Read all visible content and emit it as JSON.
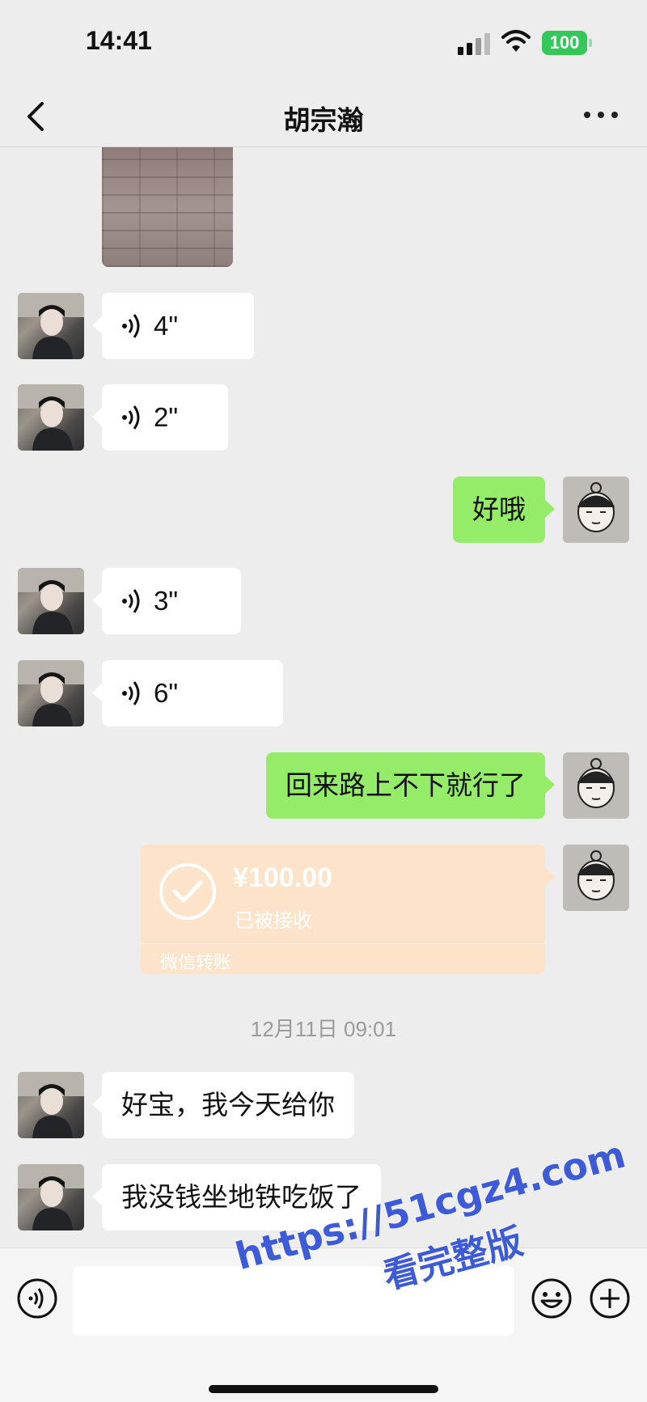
{
  "status_bar": {
    "time": "14:41",
    "battery": "100",
    "icons": [
      "signal-icon",
      "wifi-icon",
      "battery-icon"
    ]
  },
  "nav": {
    "title": "胡宗瀚",
    "back_icon": "chevron-left-icon",
    "more_icon": "more-dots-icon"
  },
  "messages": [
    {
      "type": "image",
      "side": "in"
    },
    {
      "type": "voice",
      "side": "in",
      "duration": "4\""
    },
    {
      "type": "voice",
      "side": "in",
      "duration": "2\""
    },
    {
      "type": "text",
      "side": "out",
      "text": "好哦"
    },
    {
      "type": "voice",
      "side": "in",
      "duration": "3\""
    },
    {
      "type": "voice",
      "side": "in",
      "duration": "6\""
    },
    {
      "type": "text",
      "side": "out",
      "text": "回来路上不下就行了"
    },
    {
      "type": "transfer",
      "side": "out",
      "amount": "¥100.00",
      "status": "已被接收",
      "label": "微信转账"
    },
    {
      "type": "timestamp",
      "text": "12月11日 09:01"
    },
    {
      "type": "text",
      "side": "in",
      "text": "好宝，我今天给你"
    },
    {
      "type": "text",
      "side": "in",
      "text": "我没钱坐地铁吃饭了"
    }
  ],
  "input_bar": {
    "value": "",
    "icons": [
      "voice-toggle-icon",
      "emoji-icon",
      "plus-icon"
    ]
  },
  "watermark": {
    "url": "https://51cgz4.com",
    "text": "看完整版"
  },
  "colors": {
    "background": "#ededed",
    "outgoing_bubble": "#95ec69",
    "incoming_bubble": "#ffffff",
    "transfer_card": "#fde3c9",
    "watermark": "#3d5bd8"
  }
}
